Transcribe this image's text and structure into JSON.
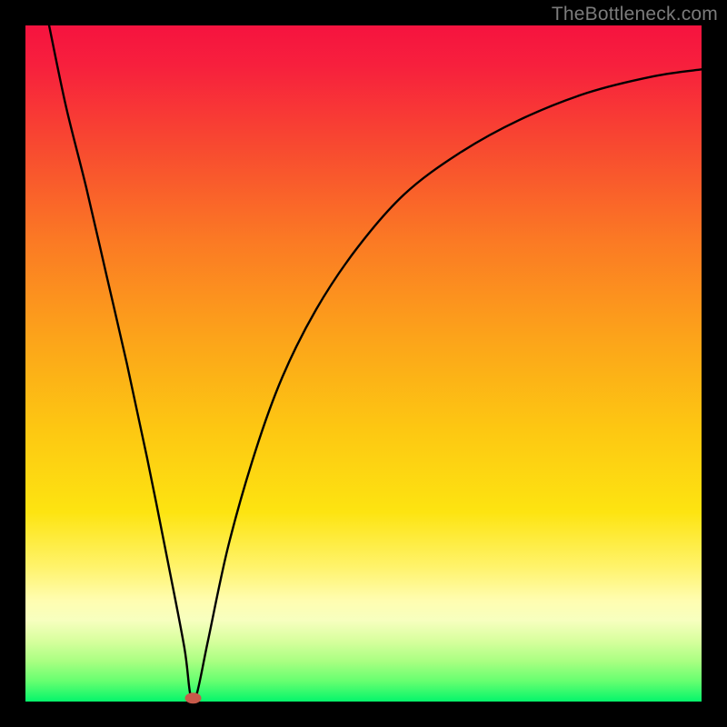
{
  "watermark": "TheBottleneck.com",
  "chart_data": {
    "type": "line",
    "title": "",
    "xlabel": "",
    "ylabel": "",
    "xlim": [
      0,
      100
    ],
    "ylim": [
      0,
      100
    ],
    "grid": false,
    "legend": false,
    "notes": "Axes are unlabeled; values are fractional positions (0–100) read from the plot. Background gradient encodes value bands from red (top, worst) to green (bottom, best). A small red marker sits at the curve minimum.",
    "series": [
      {
        "name": "curve",
        "x": [
          3.5,
          6,
          9,
          12,
          15,
          18,
          21,
          23.5,
          24.4,
          25.3,
          27,
          30,
          34,
          38,
          43,
          49,
          56,
          64,
          73,
          83,
          93,
          100
        ],
        "y": [
          100,
          88,
          76,
          63,
          50,
          36,
          21,
          8,
          1.0,
          1.0,
          9,
          23,
          37,
          48,
          58,
          67,
          75,
          81,
          86,
          90,
          92.5,
          93.5
        ]
      }
    ],
    "marker": {
      "x": 24.8,
      "y": 0.5,
      "color": "#c75a4a"
    },
    "gradient_stops": [
      {
        "pos": 0,
        "color": "#f6133f"
      },
      {
        "pos": 18,
        "color": "#f84a30"
      },
      {
        "pos": 46,
        "color": "#fca31a"
      },
      {
        "pos": 72,
        "color": "#fde411"
      },
      {
        "pos": 88,
        "color": "#f7ffbf"
      },
      {
        "pos": 100,
        "color": "#05f56b"
      }
    ]
  }
}
